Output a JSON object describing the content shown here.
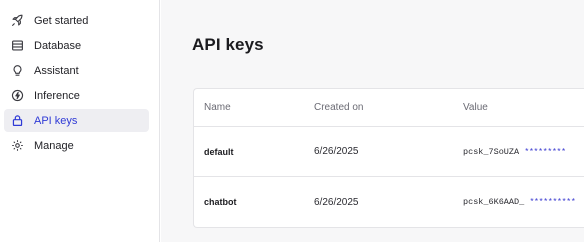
{
  "sidebar": {
    "items": [
      {
        "label": "Get started",
        "icon": "rocket-icon",
        "active": false
      },
      {
        "label": "Database",
        "icon": "database-icon",
        "active": false
      },
      {
        "label": "Assistant",
        "icon": "lightbulb-icon",
        "active": false
      },
      {
        "label": "Inference",
        "icon": "bolt-icon",
        "active": false
      },
      {
        "label": "API keys",
        "icon": "lock-icon",
        "active": true
      },
      {
        "label": "Manage",
        "icon": "gear-icon",
        "active": false
      }
    ]
  },
  "main": {
    "title": "API keys",
    "table": {
      "columns": [
        "Name",
        "Created on",
        "Value"
      ],
      "rows": [
        {
          "name": "default",
          "created_on": "6/26/2025",
          "value_prefix": "pcsk_7SoUZA",
          "value_mask": "*********"
        },
        {
          "name": "chatbot",
          "created_on": "6/26/2025",
          "value_prefix": "pcsk_6K6AAD_",
          "value_mask": "**********"
        }
      ]
    }
  },
  "colors": {
    "accent": "#2f3ad6",
    "active_bg": "#eeeef2",
    "main_bg": "#f7f7f8",
    "border": "#e4e4e7"
  }
}
